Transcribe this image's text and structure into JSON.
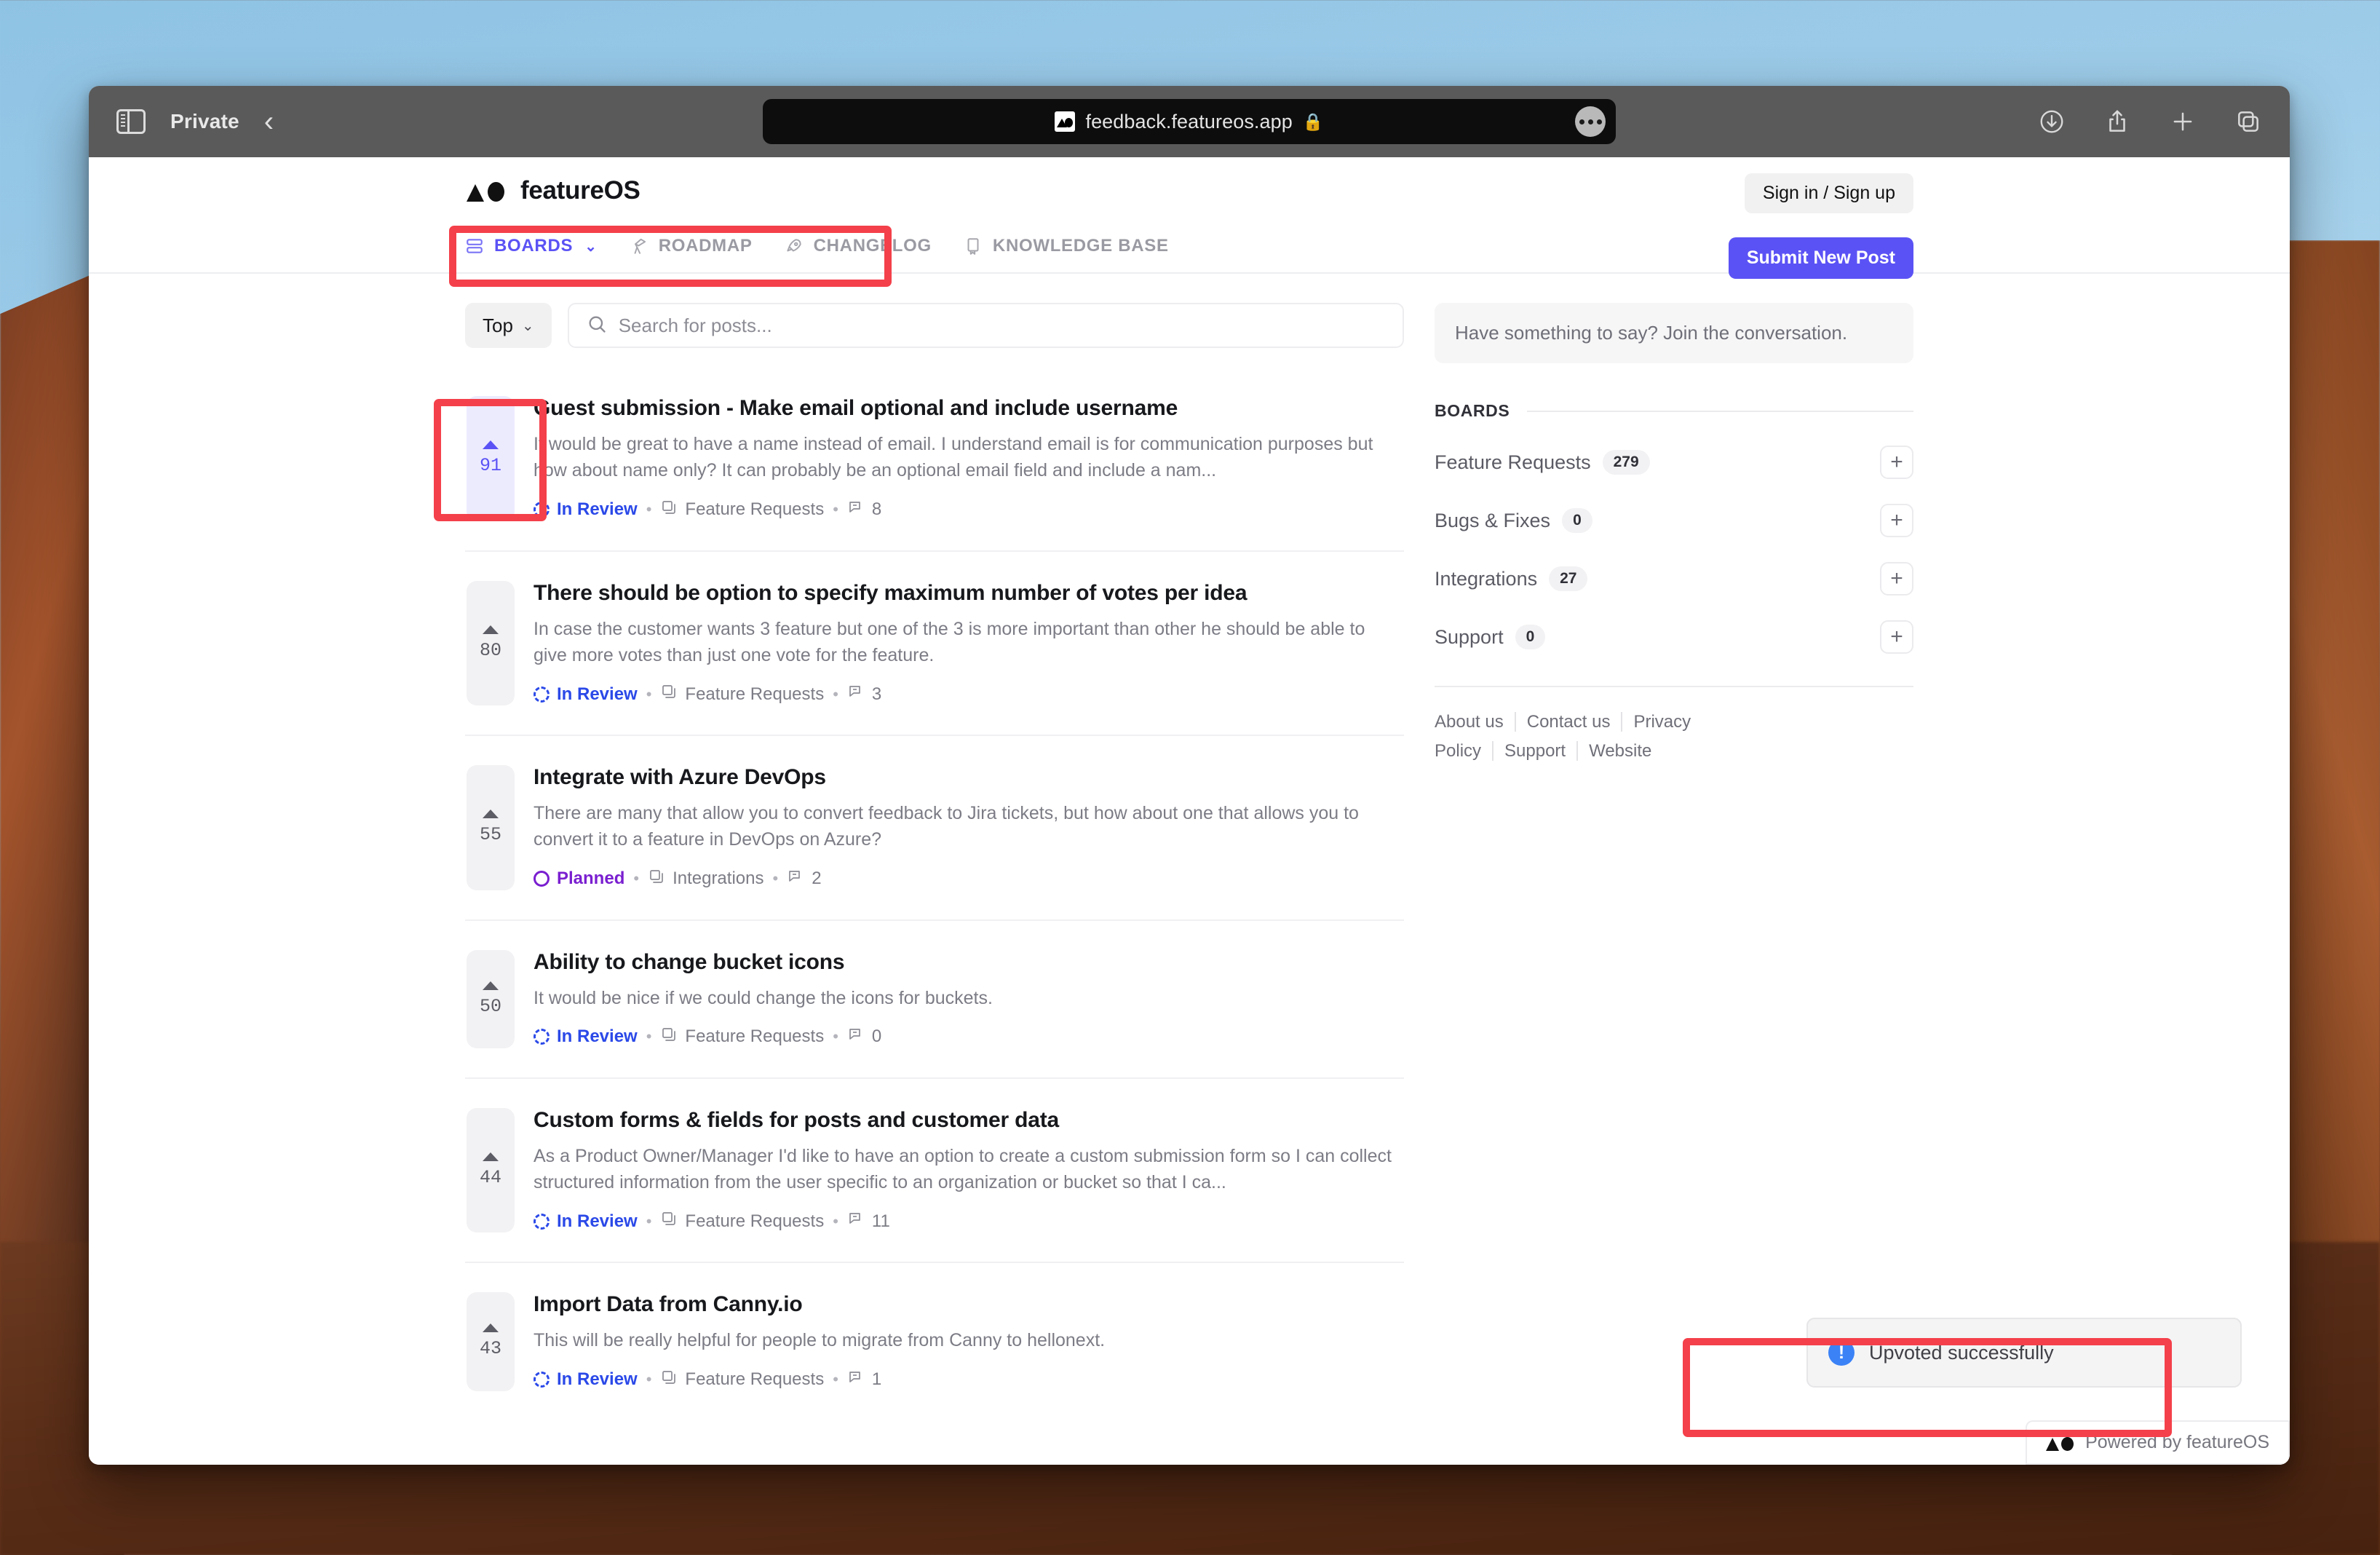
{
  "browser": {
    "profile_label": "Private",
    "back_icon": "chevron-left-icon",
    "sidebar_icon": "sidebar-toggle-icon",
    "url": "feedback.featureos.app",
    "lock_icon": "lock-icon",
    "favicon": "featureos-favicon",
    "more_icon": "page-settings-ellipsis-icon",
    "right_icons": [
      "downloads-icon",
      "share-icon",
      "new-tab-icon",
      "tab-overview-icon"
    ]
  },
  "site": {
    "brand_name": "featureOS",
    "logo_icon": "featureos-logo",
    "auth_button": "Sign in / Sign up",
    "submit_button": "Submit New Post",
    "nav": [
      {
        "label": "BOARDS",
        "icon": "boards-icon",
        "active": true,
        "has_chevron": true
      },
      {
        "label": "ROADMAP",
        "icon": "telescope-icon",
        "active": false,
        "has_chevron": false
      },
      {
        "label": "CHANGELOG",
        "icon": "rocket-icon",
        "active": false,
        "has_chevron": false
      },
      {
        "label": "KNOWLEDGE BASE",
        "icon": "book-icon",
        "active": false,
        "has_chevron": false
      }
    ]
  },
  "filters": {
    "sort_label": "Top",
    "sort_chevron_icon": "chevron-down-icon",
    "search_icon": "search-icon",
    "search_value": "",
    "search_placeholder": "Search for posts..."
  },
  "posts": [
    {
      "votes": "91",
      "voted": true,
      "title": "Guest submission - Make email optional and include username",
      "description": "It would be great to have a name instead of email. I understand email is for communication purposes but how about name only? It can probably be an optional email field and include a nam...",
      "status": "In Review",
      "status_kind": "inreview",
      "board": "Feature Requests",
      "comments": "8"
    },
    {
      "votes": "80",
      "voted": false,
      "title": "There should be option to specify maximum number of votes per idea",
      "description": "In case the customer wants 3 feature but one of the 3 is more important than other he should be able to give more votes than just one vote for the feature.",
      "status": "In Review",
      "status_kind": "inreview",
      "board": "Feature Requests",
      "comments": "3"
    },
    {
      "votes": "55",
      "voted": false,
      "title": "Integrate with Azure DevOps",
      "description": "There are many that allow you to convert feedback to Jira tickets, but how about one that allows you to convert it to a feature in DevOps on Azure?",
      "status": "Planned",
      "status_kind": "planned",
      "board": "Integrations",
      "comments": "2"
    },
    {
      "votes": "50",
      "voted": false,
      "title": "Ability to change bucket icons",
      "description": "It would be nice if we could change the icons for buckets.",
      "status": "In Review",
      "status_kind": "inreview",
      "board": "Feature Requests",
      "comments": "0"
    },
    {
      "votes": "44",
      "voted": false,
      "title": "Custom forms & fields for posts and customer data",
      "description": "As a Product Owner/Manager I'd like to have an option to create a custom submission form so I can collect structured information from the user specific to an organization or bucket so that I ca...",
      "status": "In Review",
      "status_kind": "inreview",
      "board": "Feature Requests",
      "comments": "11"
    },
    {
      "votes": "43",
      "voted": false,
      "title": "Import Data from Canny.io",
      "description": "This will be really helpful for people to migrate from Canny to hellonext.",
      "status": "In Review",
      "status_kind": "inreview",
      "board": "Feature Requests",
      "comments": "1"
    }
  ],
  "sidebar": {
    "cta": "Have something to say? Join the conversation.",
    "boards_heading": "BOARDS",
    "boards": [
      {
        "name": "Feature Requests",
        "count": "279",
        "add_icon": "plus-icon"
      },
      {
        "name": "Bugs & Fixes",
        "count": "0",
        "add_icon": "plus-icon"
      },
      {
        "name": "Integrations",
        "count": "27",
        "add_icon": "plus-icon"
      },
      {
        "name": "Support",
        "count": "0",
        "add_icon": "plus-icon"
      }
    ],
    "footer_links": [
      "About us",
      "Contact us",
      "Privacy Policy",
      "Support",
      "Website"
    ]
  },
  "toast": {
    "icon": "info-icon",
    "icon_glyph": "!",
    "message": "Upvoted successfully"
  },
  "powered": {
    "logo_icon": "featureos-logo-small",
    "text": "Powered by featureOS"
  },
  "colors": {
    "accent": "#5b52f5",
    "status_in_review": "#2b49e8",
    "status_planned": "#7a1fd0",
    "toast_info": "#3b82f6",
    "highlight": "#f4404a"
  }
}
